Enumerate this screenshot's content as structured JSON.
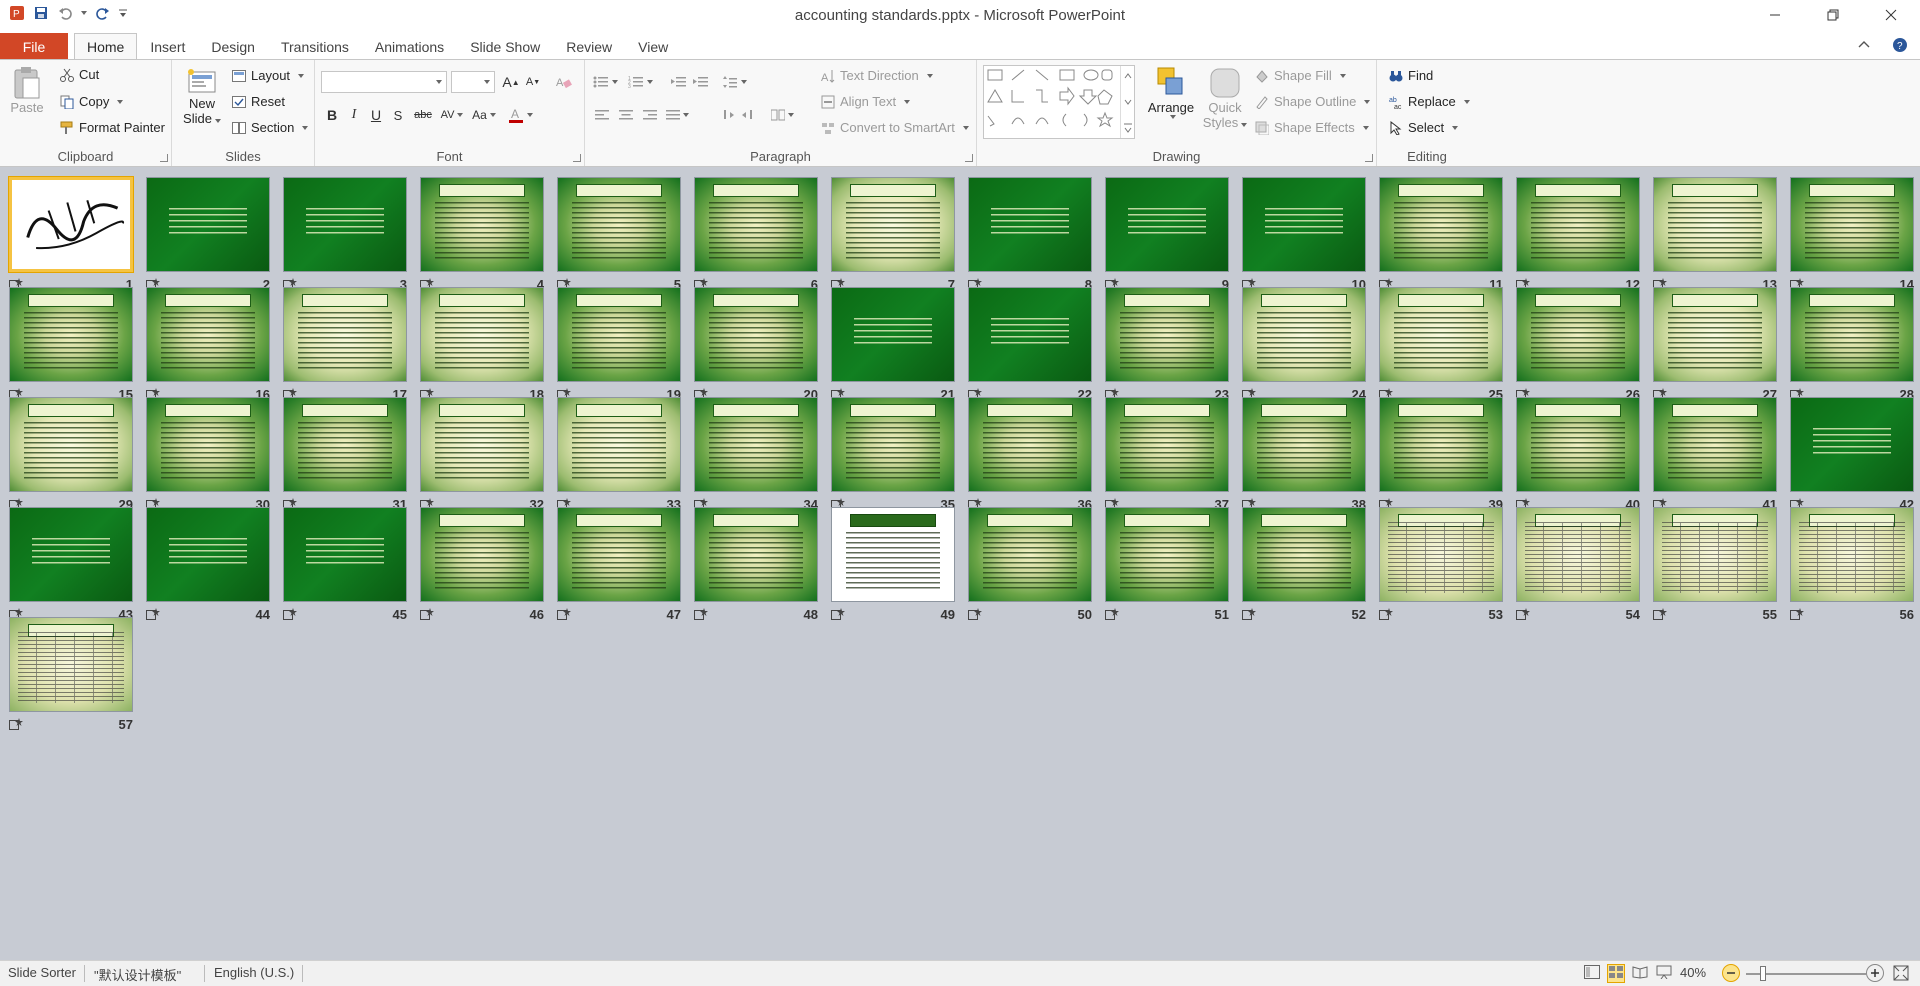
{
  "title_bar": {
    "title": "accounting standards.pptx - Microsoft PowerPoint"
  },
  "ribbon_tabs": {
    "file": "File",
    "items": [
      "Home",
      "Insert",
      "Design",
      "Transitions",
      "Animations",
      "Slide Show",
      "Review",
      "View"
    ],
    "active": "Home"
  },
  "ribbon": {
    "clipboard": {
      "label": "Clipboard",
      "paste": "Paste",
      "cut": "Cut",
      "copy": "Copy",
      "format_painter": "Format Painter"
    },
    "slides": {
      "label": "Slides",
      "new_slide_1": "New",
      "new_slide_2": "Slide",
      "layout": "Layout",
      "reset": "Reset",
      "section": "Section"
    },
    "font": {
      "label": "Font",
      "font_name": "",
      "font_size": ""
    },
    "paragraph": {
      "label": "Paragraph",
      "text_direction": "Text Direction",
      "align_text": "Align Text",
      "convert_smartart": "Convert to SmartArt"
    },
    "drawing": {
      "label": "Drawing",
      "arrange": "Arrange",
      "quick_styles_1": "Quick",
      "quick_styles_2": "Styles",
      "shape_fill": "Shape Fill",
      "shape_outline": "Shape Outline",
      "shape_effects": "Shape Effects"
    },
    "editing": {
      "label": "Editing",
      "find": "Find",
      "replace": "Replace",
      "select": "Select"
    }
  },
  "slides": [
    {
      "n": "1",
      "style": "white",
      "selected": true
    },
    {
      "n": "2",
      "style": "dark"
    },
    {
      "n": "3",
      "style": "dark"
    },
    {
      "n": "4",
      "style": "green"
    },
    {
      "n": "5",
      "style": "green"
    },
    {
      "n": "6",
      "style": "green"
    },
    {
      "n": "7",
      "style": "light"
    },
    {
      "n": "8",
      "style": "dark"
    },
    {
      "n": "9",
      "style": "dark"
    },
    {
      "n": "10",
      "style": "dark"
    },
    {
      "n": "11",
      "style": "green"
    },
    {
      "n": "12",
      "style": "green"
    },
    {
      "n": "13",
      "style": "light"
    },
    {
      "n": "14",
      "style": "green"
    },
    {
      "n": "15",
      "style": "green"
    },
    {
      "n": "16",
      "style": "green"
    },
    {
      "n": "17",
      "style": "light"
    },
    {
      "n": "18",
      "style": "light"
    },
    {
      "n": "19",
      "style": "green"
    },
    {
      "n": "20",
      "style": "green"
    },
    {
      "n": "21",
      "style": "dark"
    },
    {
      "n": "22",
      "style": "dark"
    },
    {
      "n": "23",
      "style": "green"
    },
    {
      "n": "24",
      "style": "light"
    },
    {
      "n": "25",
      "style": "light"
    },
    {
      "n": "26",
      "style": "green"
    },
    {
      "n": "27",
      "style": "light"
    },
    {
      "n": "28",
      "style": "green"
    },
    {
      "n": "29",
      "style": "light"
    },
    {
      "n": "30",
      "style": "green"
    },
    {
      "n": "31",
      "style": "green"
    },
    {
      "n": "32",
      "style": "light"
    },
    {
      "n": "33",
      "style": "light"
    },
    {
      "n": "34",
      "style": "green"
    },
    {
      "n": "35",
      "style": "green"
    },
    {
      "n": "36",
      "style": "green"
    },
    {
      "n": "37",
      "style": "green"
    },
    {
      "n": "38",
      "style": "green"
    },
    {
      "n": "39",
      "style": "green"
    },
    {
      "n": "40",
      "style": "green"
    },
    {
      "n": "41",
      "style": "green"
    },
    {
      "n": "42",
      "style": "dark"
    },
    {
      "n": "43",
      "style": "dark"
    },
    {
      "n": "44",
      "style": "dark"
    },
    {
      "n": "45",
      "style": "dark"
    },
    {
      "n": "46",
      "style": "green"
    },
    {
      "n": "47",
      "style": "green"
    },
    {
      "n": "48",
      "style": "green"
    },
    {
      "n": "49",
      "style": "white"
    },
    {
      "n": "50",
      "style": "green"
    },
    {
      "n": "51",
      "style": "green"
    },
    {
      "n": "52",
      "style": "green"
    },
    {
      "n": "53",
      "style": "table"
    },
    {
      "n": "54",
      "style": "table"
    },
    {
      "n": "55",
      "style": "table"
    },
    {
      "n": "56",
      "style": "table"
    },
    {
      "n": "57",
      "style": "table"
    }
  ],
  "status_bar": {
    "view": "Slide Sorter",
    "theme": "\"默认设计模板\"",
    "language": "English (U.S.)",
    "zoom": "40%"
  }
}
